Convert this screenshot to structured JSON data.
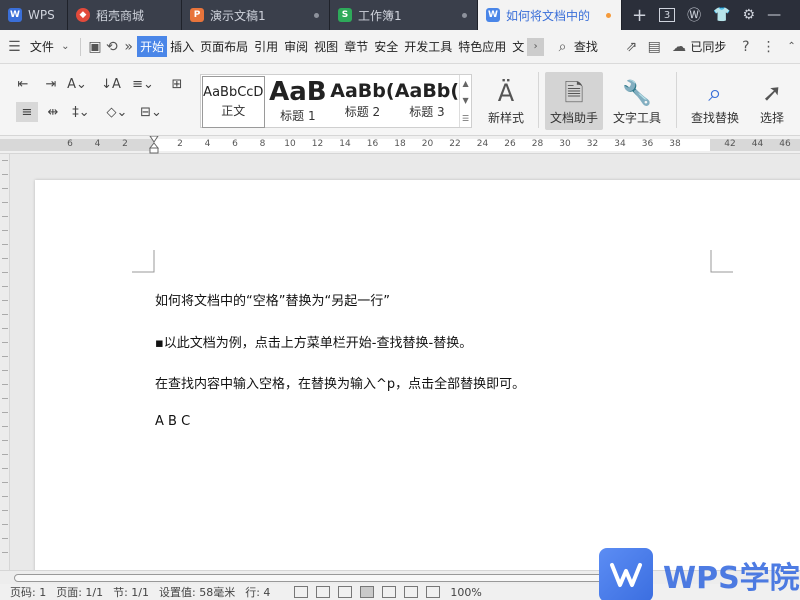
{
  "tabs": [
    {
      "label": "WPS",
      "active": false
    },
    {
      "label": "稻壳商城",
      "active": false
    },
    {
      "label": "演示文稿1",
      "active": false
    },
    {
      "label": "工作簿1",
      "active": false
    },
    {
      "label": "如何将文档中的",
      "active": true
    }
  ],
  "tab_icons": [
    "wps-logo",
    "daoke-icon",
    "ppt-icon",
    "sheet-icon",
    "writer-icon"
  ],
  "tabbar_right": {
    "window_count": "3"
  },
  "menubar": {
    "file": "文件",
    "items": [
      "开始",
      "插入",
      "页面布局",
      "引用",
      "审阅",
      "视图",
      "章节",
      "安全",
      "开发工具",
      "特色应用",
      "文"
    ],
    "active": "开始",
    "search": "查找",
    "sync": "已同步",
    "help": "?"
  },
  "ribbon": {
    "styles": [
      {
        "preview": "AaBbCcD",
        "label": "正文"
      },
      {
        "preview": "AaB",
        "label": "标题 1"
      },
      {
        "preview": "AaBb(",
        "label": "标题 2"
      },
      {
        "preview": "AaBb(",
        "label": "标题 3"
      }
    ],
    "new_style": "新样式",
    "doc_assistant": "文档助手",
    "text_tools": "文字工具",
    "find_replace": "查找替换",
    "select": "选择"
  },
  "ruler": {
    "numbers": [
      "6",
      "4",
      "2",
      "",
      "2",
      "4",
      "6",
      "8",
      "10",
      "12",
      "14",
      "16",
      "18",
      "20",
      "22",
      "24",
      "26",
      "28",
      "30",
      "32",
      "34",
      "36",
      "38",
      "",
      "42",
      "44",
      "46"
    ]
  },
  "document": {
    "lines": [
      "如何将文档中的“空格”替换为“另起一行”",
      "▪以此文档为例，点击上方菜单栏开始-查找替换-替换。",
      "在查找内容中输入空格，在替换为输入^p，点击全部替换即可。",
      "A B C"
    ]
  },
  "status": {
    "page_num": "页码: 1",
    "page": "页面: 1/1",
    "section": "节: 1/1",
    "setting": "设置值: 58毫米",
    "row": "行: 4",
    "zoom": "100%"
  },
  "watermark": {
    "text": "WPS学院"
  },
  "colors": {
    "accent": "#4a86e8",
    "tabbar": "#2b2f3a",
    "watermark": "#3b6ee0"
  }
}
